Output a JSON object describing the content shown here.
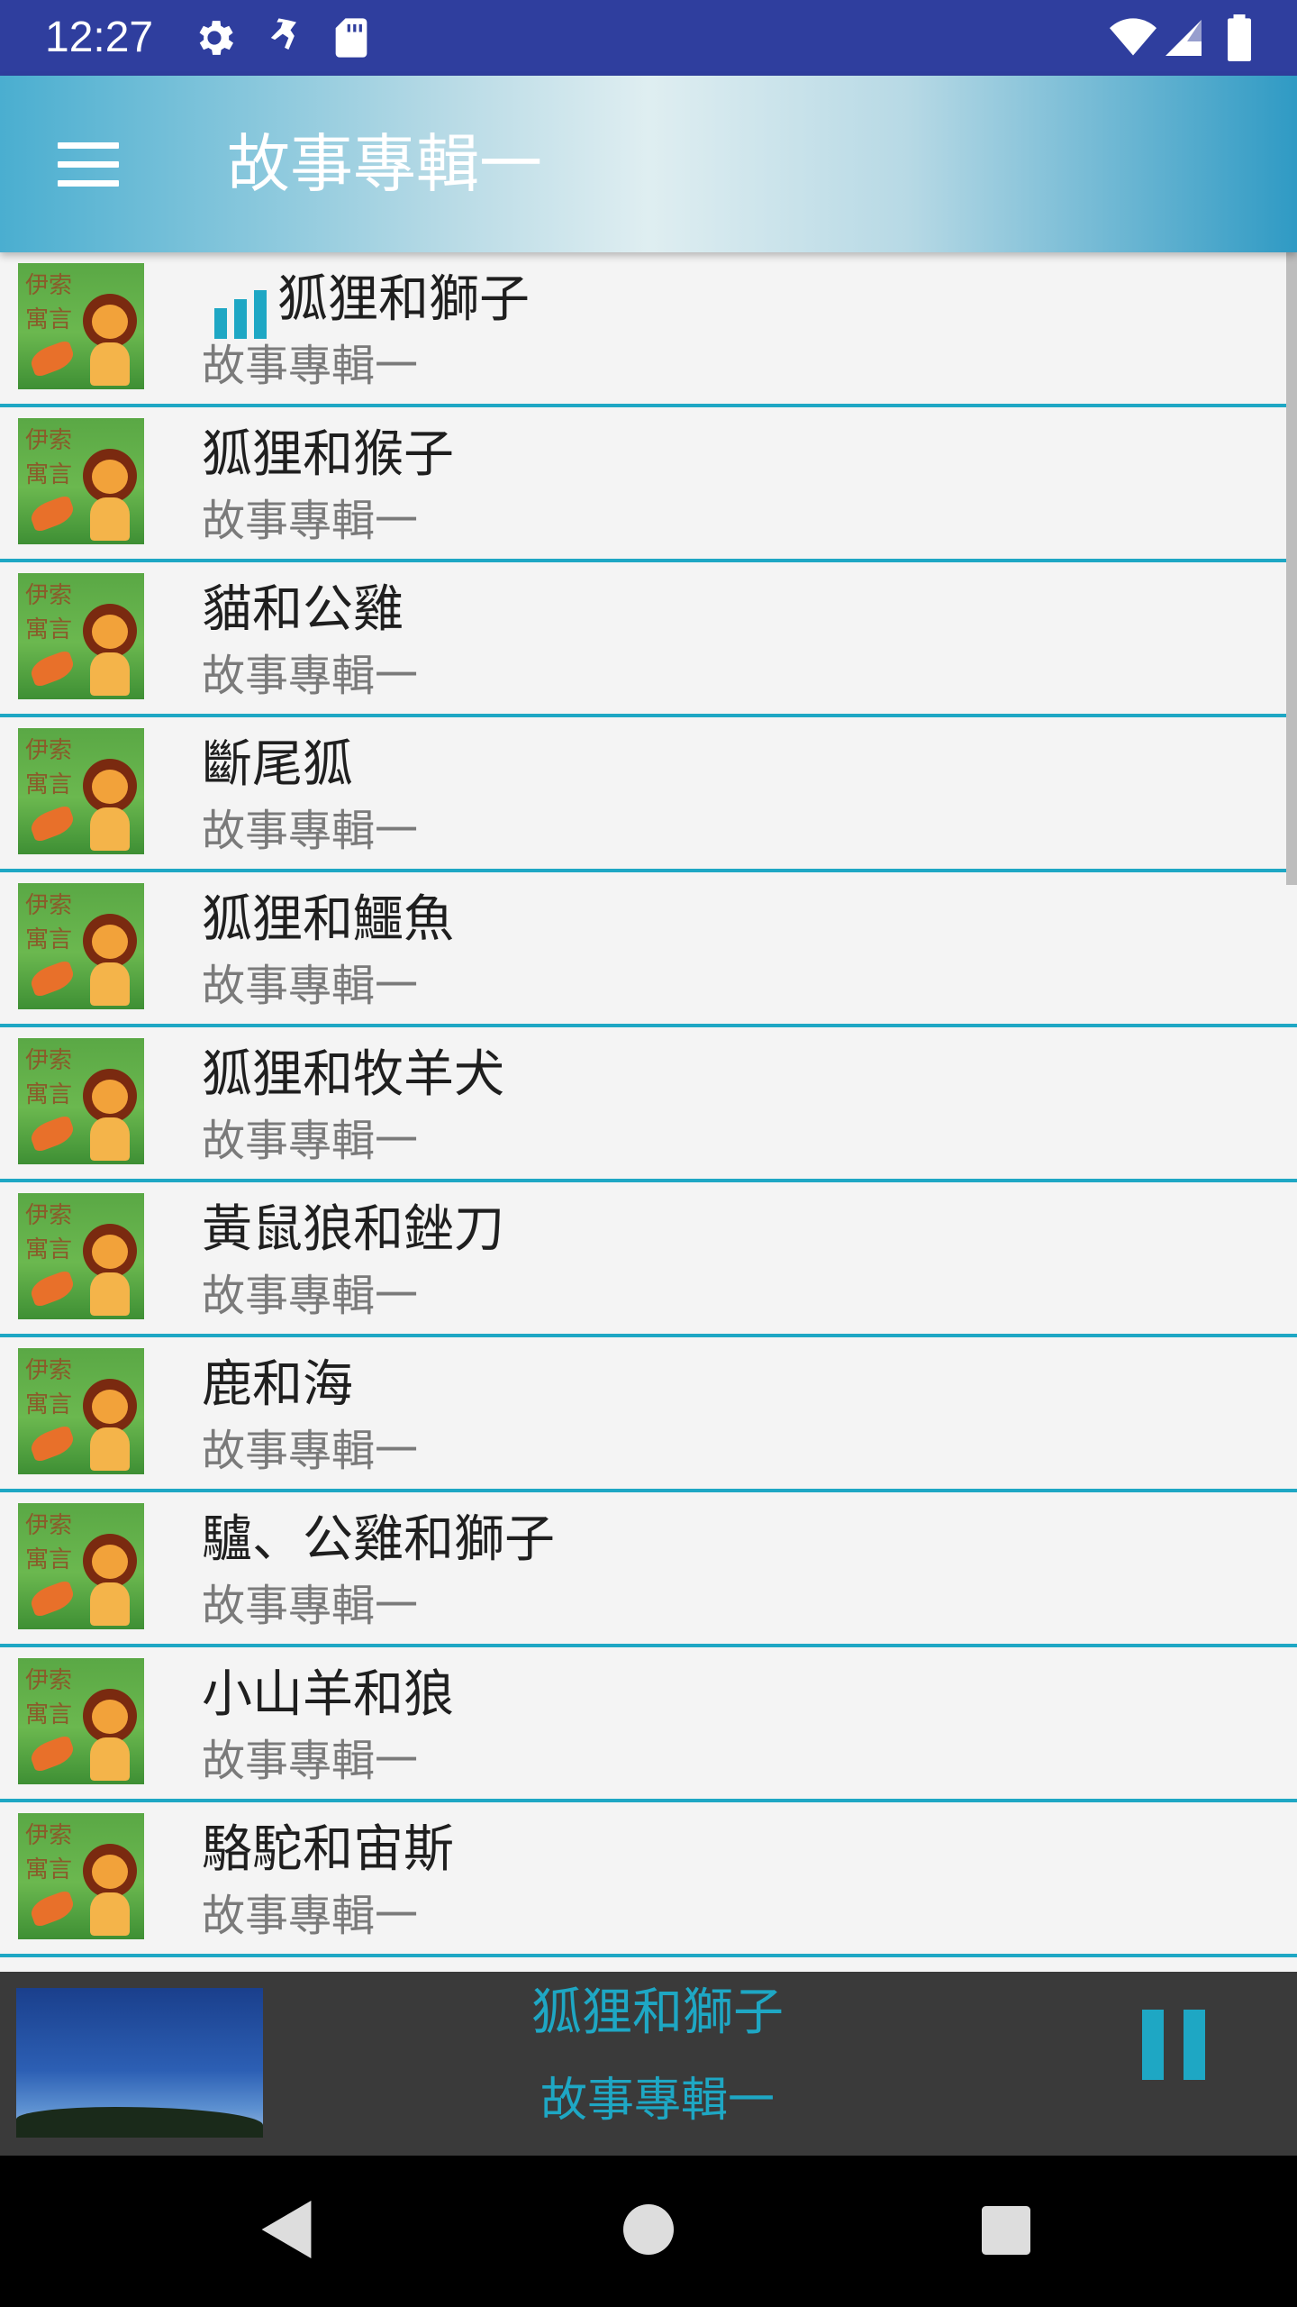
{
  "status_bar": {
    "time": "12:27",
    "left_icons": [
      "settings-icon",
      "runner-icon",
      "sd-card-icon"
    ],
    "right_icons": [
      "wifi-icon",
      "cell-signal-icon",
      "battery-icon"
    ]
  },
  "app_bar": {
    "title": "故事專輯一",
    "menu_icon": "hamburger-menu-icon",
    "accent": "#1ea7c4"
  },
  "tracks": [
    {
      "title": "狐狸和獅子",
      "album": "故事專輯一",
      "playing": true
    },
    {
      "title": "狐狸和猴子",
      "album": "故事專輯一",
      "playing": false
    },
    {
      "title": "貓和公雞",
      "album": "故事專輯一",
      "playing": false
    },
    {
      "title": "斷尾狐",
      "album": "故事專輯一",
      "playing": false
    },
    {
      "title": "狐狸和鱷魚",
      "album": "故事專輯一",
      "playing": false
    },
    {
      "title": "狐狸和牧羊犬",
      "album": "故事專輯一",
      "playing": false
    },
    {
      "title": "黃鼠狼和銼刀",
      "album": "故事專輯一",
      "playing": false
    },
    {
      "title": "鹿和海",
      "album": "故事專輯一",
      "playing": false
    },
    {
      "title": "驢、公雞和獅子",
      "album": "故事專輯一",
      "playing": false
    },
    {
      "title": "小山羊和狼",
      "album": "故事專輯一",
      "playing": false
    },
    {
      "title": "駱駝和宙斯",
      "album": "故事專輯一",
      "playing": false
    }
  ],
  "thumbnail_text": "伊索寓言",
  "now_playing": {
    "title": "狐狸和獅子",
    "album": "故事專輯一",
    "control_icon": "pause-icon"
  },
  "nav_bar": {
    "icons": [
      "back-icon",
      "home-icon",
      "recents-icon"
    ]
  }
}
